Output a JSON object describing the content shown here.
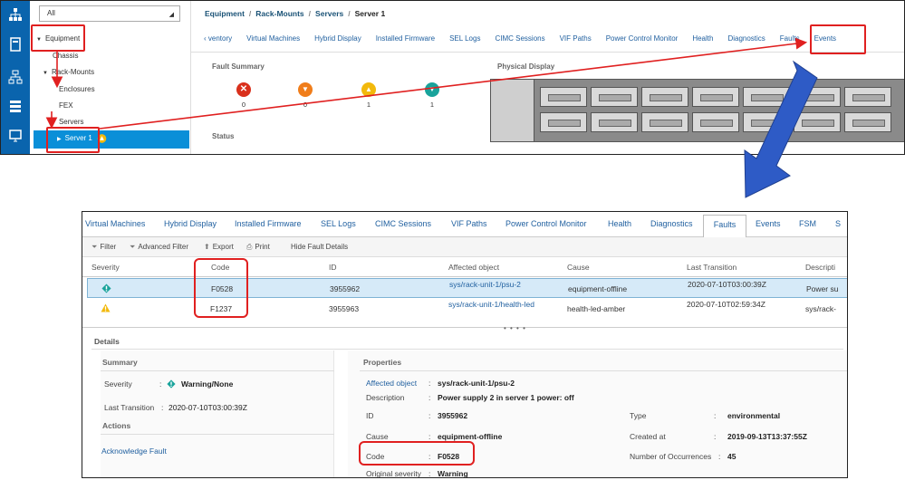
{
  "colors": {
    "rail_blue": "#0a64ad",
    "selection_blue": "#0a8fd8",
    "link_blue": "#1f5f9f",
    "annotation_red": "#e02020",
    "arrow_blue": "#2e5bc6",
    "critical": "#d9301c",
    "major": "#f07d1a",
    "minor": "#f2b90c",
    "info": "#19a39b"
  },
  "top": {
    "rail_icons": [
      "network-icon",
      "server-icon",
      "topology-icon",
      "storage-icon",
      "monitor-icon"
    ],
    "filter": {
      "value": "All"
    },
    "tree": {
      "equipment": "Equipment",
      "chassis": "Chassis",
      "rack_mounts": "Rack-Mounts",
      "enclosures": "Enclosures",
      "fex": "FEX",
      "servers": "Servers",
      "server1": "Server 1"
    },
    "breadcrumb": [
      "Equipment",
      "Rack-Mounts",
      "Servers",
      "Server 1"
    ],
    "tabs": [
      "‹ ventory",
      "Virtual Machines",
      "Hybrid Display",
      "Installed Firmware",
      "SEL Logs",
      "CIMC Sessions",
      "VIF Paths",
      "Power Control Monitor",
      "Health",
      "Diagnostics",
      "Faults",
      "Events"
    ],
    "fault_summary": {
      "title": "Fault Summary",
      "items": [
        {
          "icon": "critical-icon",
          "glyph": "✕",
          "count": "0"
        },
        {
          "icon": "major-icon",
          "glyph": "▼",
          "count": "0"
        },
        {
          "icon": "minor-icon",
          "glyph": "▲",
          "count": "1"
        },
        {
          "icon": "warning-icon",
          "glyph": "▼",
          "count": "1"
        }
      ]
    },
    "physical_display_title": "Physical Display",
    "status_title": "Status"
  },
  "bottom": {
    "tabs": [
      "Virtual Machines",
      "Hybrid Display",
      "Installed Firmware",
      "SEL Logs",
      "CIMC Sessions",
      "VIF Paths",
      "Power Control Monitor",
      "Health",
      "Diagnostics",
      "Faults",
      "Events",
      "FSM",
      "S"
    ],
    "active_tab": "Faults",
    "toolbar": {
      "filter": "Filter",
      "advanced_filter": "Advanced Filter",
      "export": "Export",
      "print": "Print",
      "hide_details": "Hide Fault Details"
    },
    "columns": [
      "Severity",
      "Code",
      "ID",
      "Affected object",
      "Cause",
      "Last Transition",
      "Descripti"
    ],
    "rows": [
      {
        "severity_icon": "info-icon",
        "code": "F0528",
        "id": "3955962",
        "affected": "sys/rack-unit-1/psu-2",
        "cause": "equipment-offline",
        "last_transition": "2020-07-10T03:00:39Z",
        "description": "Power su"
      },
      {
        "severity_icon": "minor-icon",
        "code": "F1237",
        "id": "3955963",
        "affected": "sys/rack-unit-1/health-led",
        "cause": "health-led-amber",
        "last_transition": "2020-07-10T02:59:34Z",
        "description": "sys/rack-"
      }
    ],
    "splitter": "• • • •",
    "details": {
      "title": "Details",
      "summary": {
        "title": "Summary",
        "severity_label": "Severity",
        "severity_value": "Warning/None",
        "last_transition_label": "Last Transition",
        "last_transition_value": "2020-07-10T03:00:39Z",
        "actions_title": "Actions",
        "acknowledge": "Acknowledge Fault"
      },
      "properties": {
        "title": "Properties",
        "affected_label": "Affected object",
        "affected_value": "sys/rack-unit-1/psu-2",
        "description_label": "Description",
        "description_value": "Power supply 2 in server 1 power: off",
        "id_label": "ID",
        "id_value": "3955962",
        "type_label": "Type",
        "type_value": "environmental",
        "cause_label": "Cause",
        "cause_value": "equipment-offline",
        "created_label": "Created at",
        "created_value": "2019-09-13T13:37:55Z",
        "code_label": "Code",
        "code_value": "F0528",
        "occurrences_label": "Number of Occurrences",
        "occurrences_value": "45",
        "orig_sev_label": "Original severity",
        "orig_sev_value": "Warning"
      }
    }
  }
}
